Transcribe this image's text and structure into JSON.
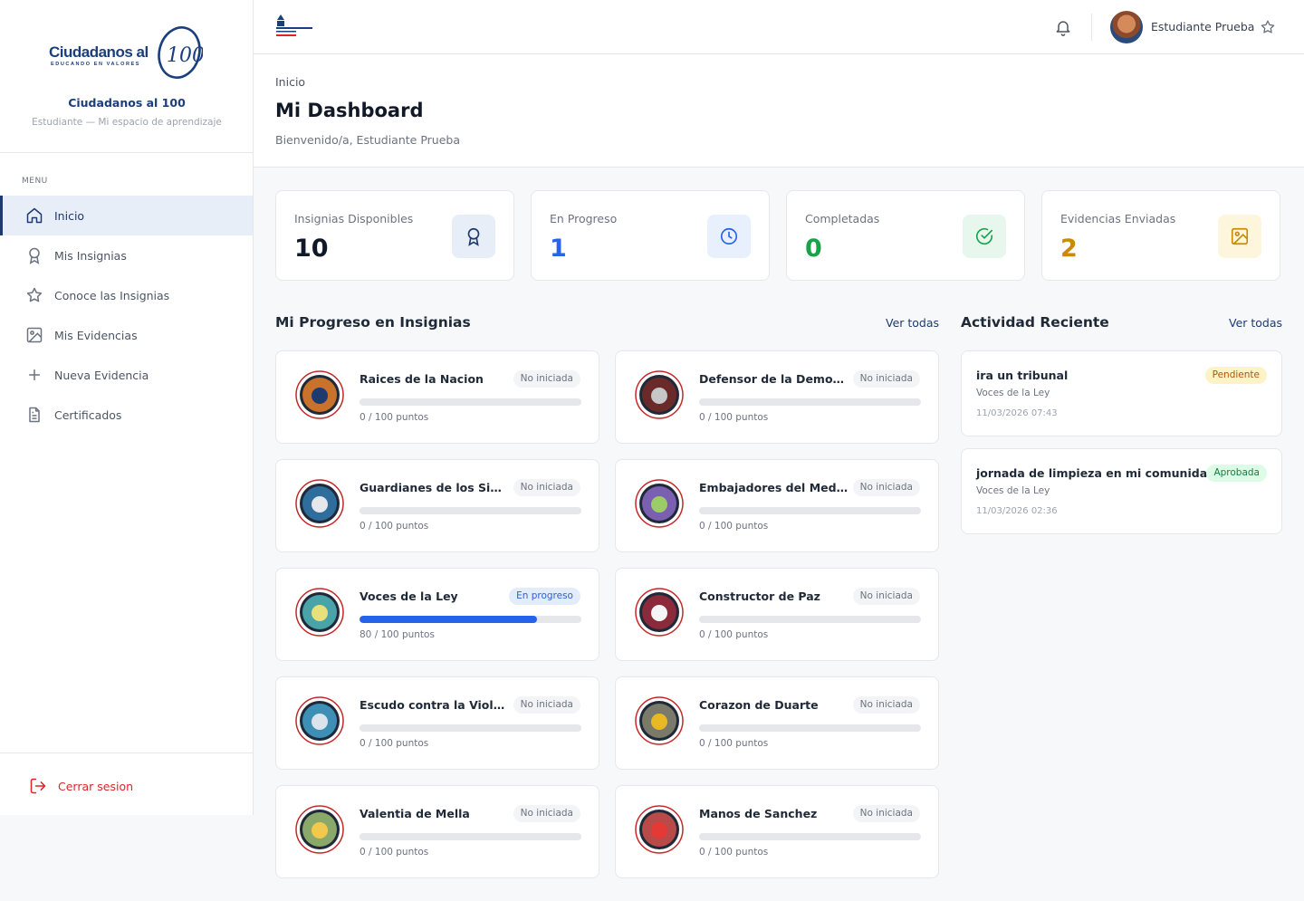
{
  "brand": {
    "logo_text": "Ciudadanos al",
    "logo_tagline": "EDUCANDO EN VALORES",
    "logo_number": "100",
    "name": "Ciudadanos al 100",
    "subtitle": "Estudiante — Mi espacio de aprendizaje"
  },
  "sidebar": {
    "menu_title": "MENU",
    "items": [
      {
        "label": "Inicio",
        "icon": "home-icon",
        "active": true
      },
      {
        "label": "Mis Insignias",
        "icon": "award-icon",
        "active": false
      },
      {
        "label": "Conoce las Insignias",
        "icon": "star-icon",
        "active": false
      },
      {
        "label": "Mis Evidencias",
        "icon": "image-icon",
        "active": false
      },
      {
        "label": "Nueva Evidencia",
        "icon": "plus-icon",
        "active": false
      },
      {
        "label": "Certificados",
        "icon": "document-icon",
        "active": false
      }
    ],
    "logout_label": "Cerrar sesion"
  },
  "topbar": {
    "user_name": "Estudiante Prueba"
  },
  "header": {
    "breadcrumb": "Inicio",
    "title": "Mi Dashboard",
    "welcome": "Bienvenido/a, Estudiante Prueba"
  },
  "stats": [
    {
      "label": "Insignias Disponibles",
      "value": "10",
      "color": "#111827",
      "icon": "award-icon",
      "icon_bg": "#e8eef7",
      "icon_color": "#1e3a6e"
    },
    {
      "label": "En Progreso",
      "value": "1",
      "color": "#2563eb",
      "icon": "clock-icon",
      "icon_bg": "#e8f0fe",
      "icon_color": "#2563eb"
    },
    {
      "label": "Completadas",
      "value": "0",
      "color": "#16a34a",
      "icon": "check-circle-icon",
      "icon_bg": "#e7f7ee",
      "icon_color": "#16a34a"
    },
    {
      "label": "Evidencias Enviadas",
      "value": "2",
      "color": "#ca8a04",
      "icon": "image-icon",
      "icon_bg": "#fef6dc",
      "icon_color": "#ca8a04"
    }
  ],
  "progress_section": {
    "title": "Mi Progreso en Insignias",
    "link": "Ver todas",
    "badges": [
      {
        "name": "Raices de la Nacion",
        "status": "No iniciada",
        "progress": 0,
        "points": "0 / 100 puntos",
        "art_bg": "#c9722b",
        "art_fg": "#1e3a6e"
      },
      {
        "name": "Defensor de la Democracia",
        "status": "No iniciada",
        "progress": 0,
        "points": "0 / 100 puntos",
        "art_bg": "#6b2a2a",
        "art_fg": "#c7c7c7"
      },
      {
        "name": "Guardianes de los Simbolos",
        "status": "No iniciada",
        "progress": 0,
        "points": "0 / 100 puntos",
        "art_bg": "#2e6d9c",
        "art_fg": "#e5e7eb"
      },
      {
        "name": "Embajadores del Medio Ambiente",
        "status": "No iniciada",
        "progress": 0,
        "points": "0 / 100 puntos",
        "art_bg": "#7b5fb0",
        "art_fg": "#9ccc65"
      },
      {
        "name": "Voces de la Ley",
        "status": "En progreso",
        "progress": 0.8,
        "points": "80 / 100 puntos",
        "art_bg": "#4aa3a8",
        "art_fg": "#e8e07a"
      },
      {
        "name": "Constructor de Paz",
        "status": "No iniciada",
        "progress": 0,
        "points": "0 / 100 puntos",
        "art_bg": "#8b2a3a",
        "art_fg": "#f5f5f5"
      },
      {
        "name": "Escudo contra la Violencia",
        "status": "No iniciada",
        "progress": 0,
        "points": "0 / 100 puntos",
        "art_bg": "#3d8fb5",
        "art_fg": "#dbe4ea"
      },
      {
        "name": "Corazon de Duarte",
        "status": "No iniciada",
        "progress": 0,
        "points": "0 / 100 puntos",
        "art_bg": "#7a7a6a",
        "art_fg": "#e8b923"
      },
      {
        "name": "Valentia de Mella",
        "status": "No iniciada",
        "progress": 0,
        "points": "0 / 100 puntos",
        "art_bg": "#8aa86a",
        "art_fg": "#f2c94c"
      },
      {
        "name": "Manos de Sanchez",
        "status": "No iniciada",
        "progress": 0,
        "points": "0 / 100 puntos",
        "art_bg": "#b84a4a",
        "art_fg": "#e53935"
      }
    ]
  },
  "activity_section": {
    "title": "Actividad Reciente",
    "link": "Ver todas",
    "items": [
      {
        "title": "ira un tribunal",
        "badge": "Voces de la Ley",
        "time": "11/03/2026 07:43",
        "status": "Pendiente",
        "kind": "pend"
      },
      {
        "title": "jornada de limpieza en mi comunidad",
        "badge": "Voces de la Ley",
        "time": "11/03/2026 02:36",
        "status": "Aprobada",
        "kind": "ok"
      }
    ]
  }
}
